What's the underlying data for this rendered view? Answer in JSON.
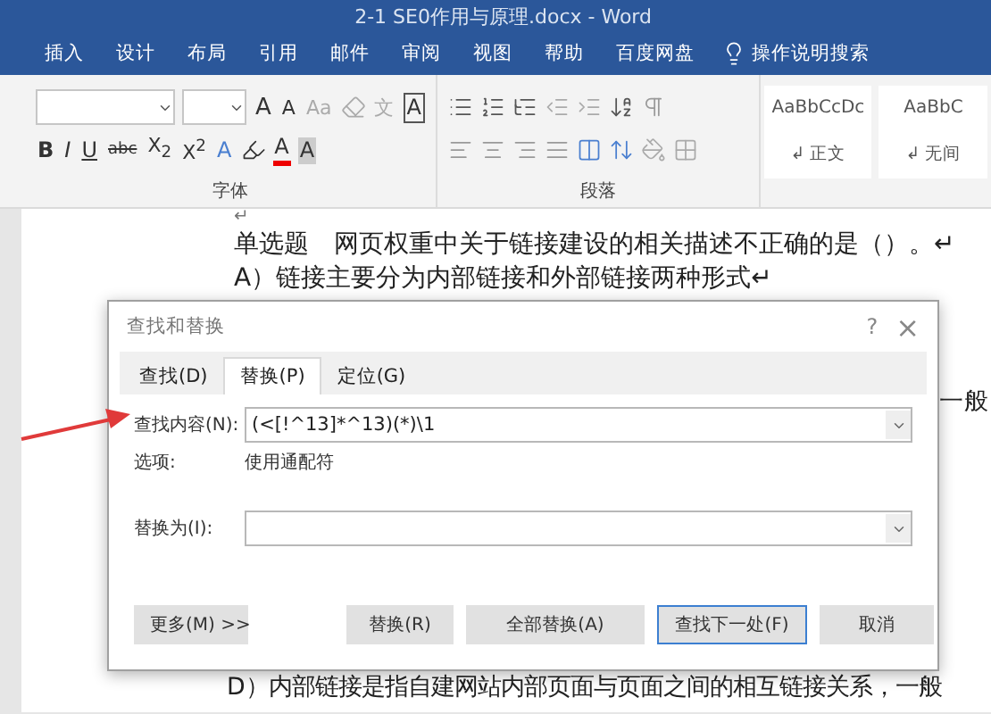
{
  "window": {
    "title": "2-1 SE0作用与原理.docx  -  Word"
  },
  "ribbon_tabs": [
    {
      "label": "插入"
    },
    {
      "label": "设计"
    },
    {
      "label": "布局"
    },
    {
      "label": "引用"
    },
    {
      "label": "邮件"
    },
    {
      "label": "审阅"
    },
    {
      "label": "视图"
    },
    {
      "label": "帮助"
    },
    {
      "label": "百度网盘"
    }
  ],
  "tell_me": "操作说明搜索",
  "font_group": {
    "label": "字体",
    "row1": [
      "A",
      "A",
      "Aa",
      "文",
      "A"
    ],
    "row2": [
      "B",
      "I",
      "U",
      "abc",
      "X$_{2}$",
      "X$^{2}$",
      "A",
      "A",
      "A"
    ]
  },
  "paragraph_group": {
    "label": "段落"
  },
  "styles": [
    {
      "sample": "AaBbCcDc",
      "name": "↲ 正文"
    },
    {
      "sample": "AaBbC",
      "name": "↲ 无间"
    }
  ],
  "document": {
    "mark": "↵",
    "lines": [
      "单选题　网页权重中关于链接建设的相关描述不正确的是（）。↵",
      "A）链接主要分为内部链接和外部链接两种形式↵"
    ],
    "right_fragment": "一般",
    "last_line": "D）内部链接是指自建网站内部页面与页面之间的相互链接关系，一般"
  },
  "dialog": {
    "title": "查找和替换",
    "help": "?",
    "close": "×",
    "tabs": [
      {
        "label": "查找(D)",
        "selected": false
      },
      {
        "label": "替换(P)",
        "selected": true
      },
      {
        "label": "定位(G)",
        "selected": false
      }
    ],
    "find_label": "查找内容(N):",
    "find_value": "(<[!^13]*^13)(*)\\1",
    "options_label": "选项:",
    "options_value": "使用通配符",
    "replace_label": "替换为(I):",
    "buttons": [
      {
        "label": "更多(M) >>",
        "focused": false
      },
      {
        "label": "替换(R)",
        "focused": false
      },
      {
        "label": "全部替换(A)",
        "focused": false
      },
      {
        "label": "查找下一处(F)",
        "focused": true
      },
      {
        "label": "取消",
        "focused": false
      }
    ]
  }
}
